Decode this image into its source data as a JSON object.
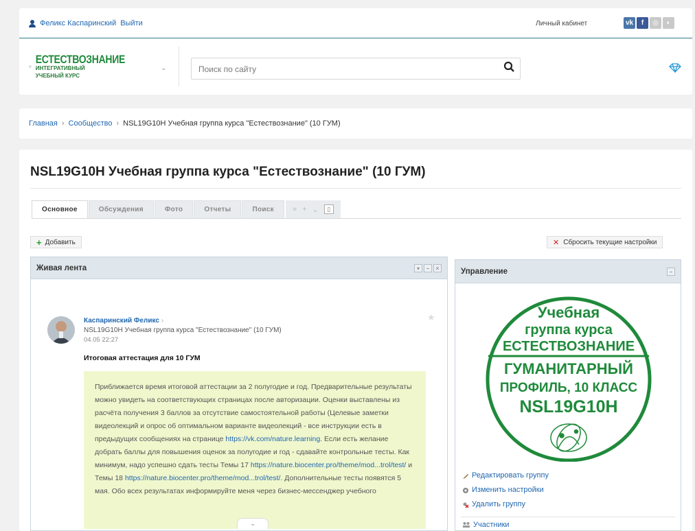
{
  "user": {
    "name": "Феликс Каспаринский",
    "logout": "Выйти"
  },
  "header": {
    "cabinet": "Личный кабинет",
    "socials": [
      "vk",
      "f",
      "ig",
      "ok"
    ]
  },
  "logo": {
    "line1": "ЕСТЕСТВОЗНАНИЕ",
    "line2": "ИНТЕГРАТИВНЫЙ",
    "line3": "УЧЕБНЫЙ КУРС"
  },
  "search": {
    "placeholder": "Поиск по сайту"
  },
  "breadcrumb": {
    "home": "Главная",
    "community": "Сообщество",
    "current": "NSL19G10H Учебная группа курса \"Естествознание\" (10 ГУМ)"
  },
  "page": {
    "title": "NSL19G10H Учебная группа курса \"Естествознание\" (10 ГУМ)"
  },
  "tabs": [
    "Основное",
    "Обсуждения",
    "Фото",
    "Отчеты",
    "Поиск"
  ],
  "tab_tools": {
    "more": "»",
    "add": "+",
    "dropdown": "⌄"
  },
  "toolbar": {
    "add": "Добавить",
    "reset": "Сбросить текущие настройки"
  },
  "feed": {
    "title": "Живая лента",
    "post": {
      "author": "Каспаринский Феликс",
      "group": "NSL19G10H Учебная группа курса \"Естествознание\" (10 ГУМ)",
      "date": "04.05 22:27",
      "title": "Итоговая аттестация для 10 ГУМ",
      "body_1": "Приближается время итоговой аттестации за 2 полугодие и год. Предварительные результаты можно увидеть на соответствующих страницах после авторизации. Оценки выставлены из расчёта получения 3 баллов за отсутствие самостоятельной работы (Целевые заметки видеолекций и опрос об оптимальном варианте видеолекций - все инструкции есть в предыдущих сообщениях на странице",
      "link_1": "https://vk.com/nature.learning",
      "body_2": ". Если есть желание добрать баллы для повышения оценок за полугодие и год - сдавайте контрольные тесты. Как минимум, надо успешно сдать тесты Темы 17",
      "link_2": "https://nature.biocenter.pro/theme/mod...trol/test/",
      "body_3": " и Темы 18",
      "link_3": "https://nature.biocenter.pro/theme/mod...trol/test/",
      "body_4": ". Дополнительные тесты появятся 5 мая. Обо всех результатах информируйте меня через бизнес-мессенджер учебного"
    }
  },
  "control": {
    "title": "Управление",
    "stamp": {
      "line1": "Учебная",
      "line2": "группа курса",
      "line3": "ЕСТЕСТВОЗНАНИЕ",
      "line4": "ГУМАНИТАРНЫЙ",
      "line5": "ПРОФИЛЬ, 10 КЛАСС",
      "line6": "NSL19G10H"
    },
    "links": [
      "Редактировать группу",
      "Изменить настройки",
      "Удалить группу"
    ],
    "members": "Участники"
  },
  "colors": {
    "accent": "#2067b0",
    "teal": "#2f7a87",
    "stamp_green": "#1f8a3b",
    "quote_bg": "#f0f7cd",
    "panel_head": "#dfe6ec"
  }
}
